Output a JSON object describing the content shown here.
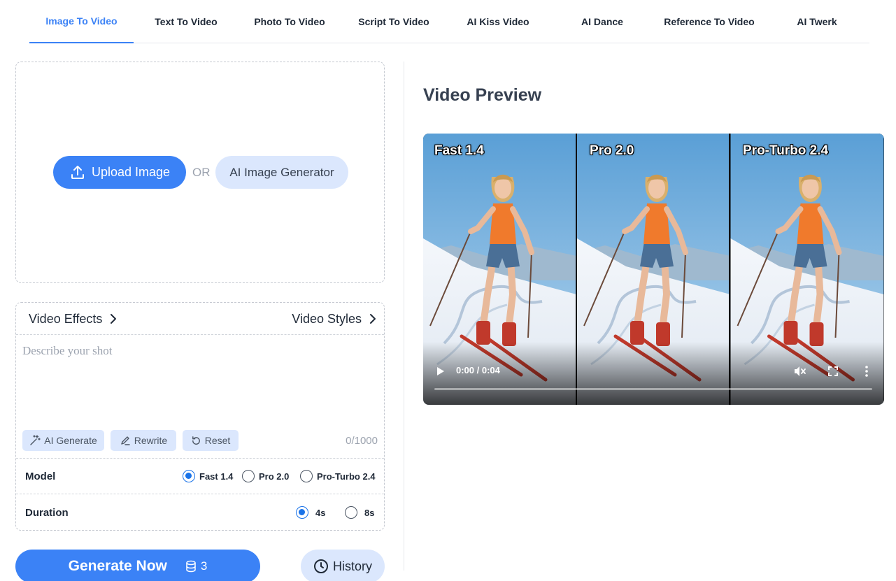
{
  "tabs": [
    {
      "label": "Image To Video",
      "active": true
    },
    {
      "label": "Text To Video",
      "active": false
    },
    {
      "label": "Photo To Video",
      "active": false
    },
    {
      "label": "Script To Video",
      "active": false
    },
    {
      "label": "AI Kiss Video",
      "active": false
    },
    {
      "label": "AI Dance",
      "active": false
    },
    {
      "label": "Reference To Video",
      "active": false
    },
    {
      "label": "AI Twerk",
      "active": false
    }
  ],
  "upload": {
    "upload_label": "Upload Image",
    "or_label": "OR",
    "ai_generator_label": "AI Image Generator"
  },
  "prompt": {
    "effects_label": "Video Effects",
    "styles_label": "Video Styles",
    "placeholder": "Describe your shot",
    "value": "",
    "ai_generate_label": "AI Generate",
    "rewrite_label": "Rewrite",
    "reset_label": "Reset",
    "counter": "0/1000"
  },
  "model": {
    "label": "Model",
    "options": [
      "Fast 1.4",
      "Pro 2.0",
      "Pro-Turbo 2.4"
    ],
    "selected": "Fast 1.4"
  },
  "duration": {
    "label": "Duration",
    "options": [
      "4s",
      "8s"
    ],
    "selected": "4s"
  },
  "generate": {
    "label": "Generate Now",
    "credits": "3"
  },
  "history_label": "History",
  "preview": {
    "title": "Video Preview",
    "panes": [
      "Fast 1.4",
      "Pro 2.0",
      "Pro-Turbo 2.4"
    ],
    "time": "0:00 / 0:04",
    "progress": 0.0,
    "muted": true
  },
  "colors": {
    "accent": "#3b82f6",
    "accent_light": "#dbe7fd",
    "radio": "#1a73e8"
  },
  "icons": {
    "upload": "upload-icon",
    "chevron": "chevron-right-icon",
    "magic": "magic-wand-icon",
    "rewrite": "pencil-icon",
    "reset": "reset-icon",
    "credit": "database-icon",
    "history": "clock-icon",
    "play": "play-icon",
    "mute": "mute-icon",
    "fullscreen": "fullscreen-icon",
    "more": "more-vertical-icon"
  }
}
